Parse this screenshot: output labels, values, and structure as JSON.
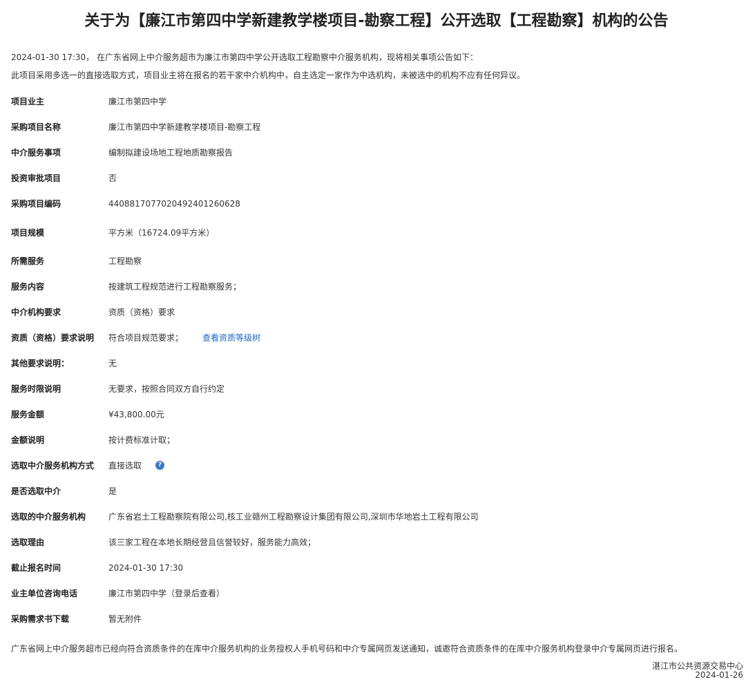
{
  "title": "关于为【廉江市第四中学新建教学楼项目-勘察工程】公开选取【工程勘察】机构的公告",
  "intro": {
    "line1": "2024-01-30 17:30， 在广东省网上中介服务超市为廉江市第四中学公开选取工程勘察中介服务机构，现将相关事项公告如下：",
    "line2": "此项目采用多选一的直接选取方式，项目业主将在报名的若干家中介机构中，自主选定一家作为中选机构，未被选中的机构不应有任何异议。"
  },
  "fields": {
    "owner": {
      "label": "项目业主",
      "value": "廉江市第四中学"
    },
    "project_name": {
      "label": "采购项目名称",
      "value": "廉江市第四中学新建教学楼项目-勘察工程"
    },
    "service_item": {
      "label": "中介服务事项",
      "value": "编制拟建设场地工程地质勘察报告"
    },
    "investment_approval": {
      "label": "投资审批项目",
      "value": "否"
    },
    "project_code": {
      "label": "采购项目编码",
      "value": "440881707702049240126062​8"
    },
    "scale": {
      "label": "项目规模",
      "value": "平方米（16724.09平方米）"
    },
    "required_service": {
      "label": "所需服务",
      "value": "工程勘察"
    },
    "service_content": {
      "label": "服务内容",
      "value": "按建筑工程规范进行工程勘察服务；"
    },
    "agency_requirement": {
      "label": "中介机构要求",
      "value": "资质（资格）要求"
    },
    "qualification_desc": {
      "label": "资质（资格）要求说明",
      "value": "符合项目规范要求；",
      "link": "查看资质等级树"
    },
    "other_requirements": {
      "label": "其他要求说明：",
      "value": "无"
    },
    "service_period": {
      "label": "服务时限说明",
      "value": "无要求，按照合同双方自行约定"
    },
    "service_amount": {
      "label": "服务金额",
      "value": "¥43,800.00元"
    },
    "amount_desc": {
      "label": "金额说明",
      "value": "按计费标准计取；"
    },
    "selection_method": {
      "label": "选取中介服务机构方式",
      "value": "直接选取"
    },
    "is_selected": {
      "label": "是否选取中介",
      "value": "是"
    },
    "selected_agencies": {
      "label": "选取的中介服务机构",
      "value": "广东省岩土工程勘察院有限公司,核工业赣州工程勘察设计集团有限公司,深圳市华地岩土工程有限公司"
    },
    "selection_reason": {
      "label": "选取理由",
      "value": "该三家工程在本地长期经营且信誉较好，服务能力高效；"
    },
    "deadline": {
      "label": "截止报名时间",
      "value": "2024-01-30 17:30"
    },
    "contact_phone": {
      "label": "业主单位咨询电话",
      "value": "廉江市第四中学（登录后查看）"
    },
    "download": {
      "label": "采购需求书下载",
      "value": "暂无附件"
    }
  },
  "help_icon_glyph": "?",
  "footer": {
    "note": "广东省网上中介服务超市已经向符合资质条件的在库中介服务机构的业务授权人手机号码和中介专属网页发送通知，诚邀符合资质条件的在库中介服务机构登录中介专属网页进行报名。",
    "organization": "湛江市公共资源交易中心",
    "date": "2024-01-26"
  },
  "colors": {
    "link": "#1a66c9",
    "help_icon": "#3a78c8",
    "text": "#333333"
  }
}
